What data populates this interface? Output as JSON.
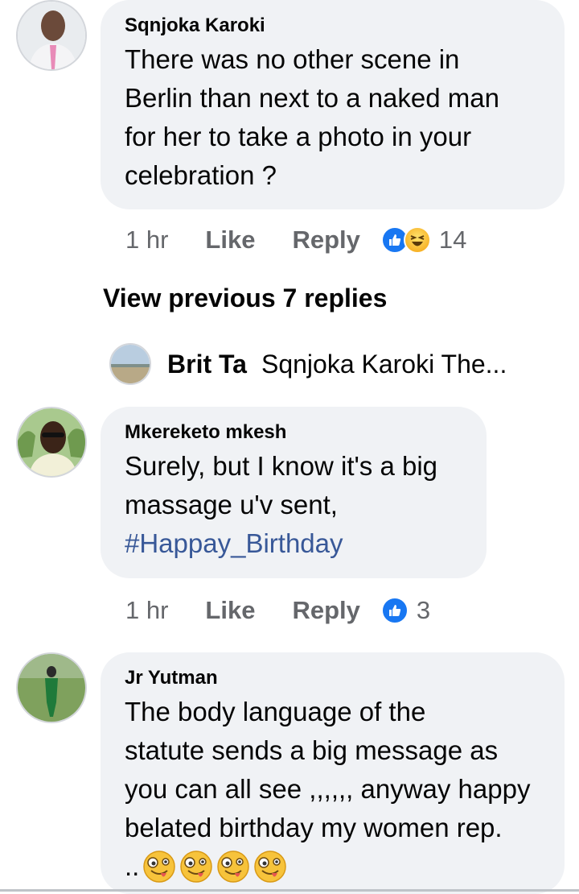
{
  "comments": [
    {
      "author": "Sqnjoka Karoki",
      "lines": [
        "There was no other scene in",
        "Berlin than  next to a naked man",
        "for her to take a  photo in your",
        "celebration ?"
      ],
      "time": "1 hr",
      "like_label": "Like",
      "reply_label": "Reply",
      "reaction_count": "14",
      "reactions": [
        "like-icon",
        "haha-icon"
      ]
    },
    {
      "author": "Mkereketo mkesh",
      "lines": [
        "Surely, but I know it's a big",
        "massage u'v sent,"
      ],
      "hashtag": "#Happay_Birthday",
      "time": "1 hr",
      "like_label": "Like",
      "reply_label": "Reply",
      "reaction_count": "3",
      "reactions": [
        "like-icon"
      ]
    },
    {
      "author": "Jr Yutman",
      "lines": [
        "The body language of the",
        "statute sends a big message as",
        "you can all see ,,,,,, anyway happy",
        "belated birthday my women rep."
      ],
      "last_line_prefix": "..",
      "emojis": [
        "crazy-face-icon",
        "crazy-face-icon",
        "crazy-face-icon",
        "crazy-face-icon"
      ]
    }
  ],
  "view_previous": "View previous 7 replies",
  "reply_preview": {
    "author": "Brit Ta",
    "snippet": "Sqnjoka Karoki The..."
  },
  "colors": {
    "bubble": "#f0f2f5",
    "meta_text": "#65676b",
    "like_blue": "#1877f2",
    "hashtag": "#385898"
  }
}
